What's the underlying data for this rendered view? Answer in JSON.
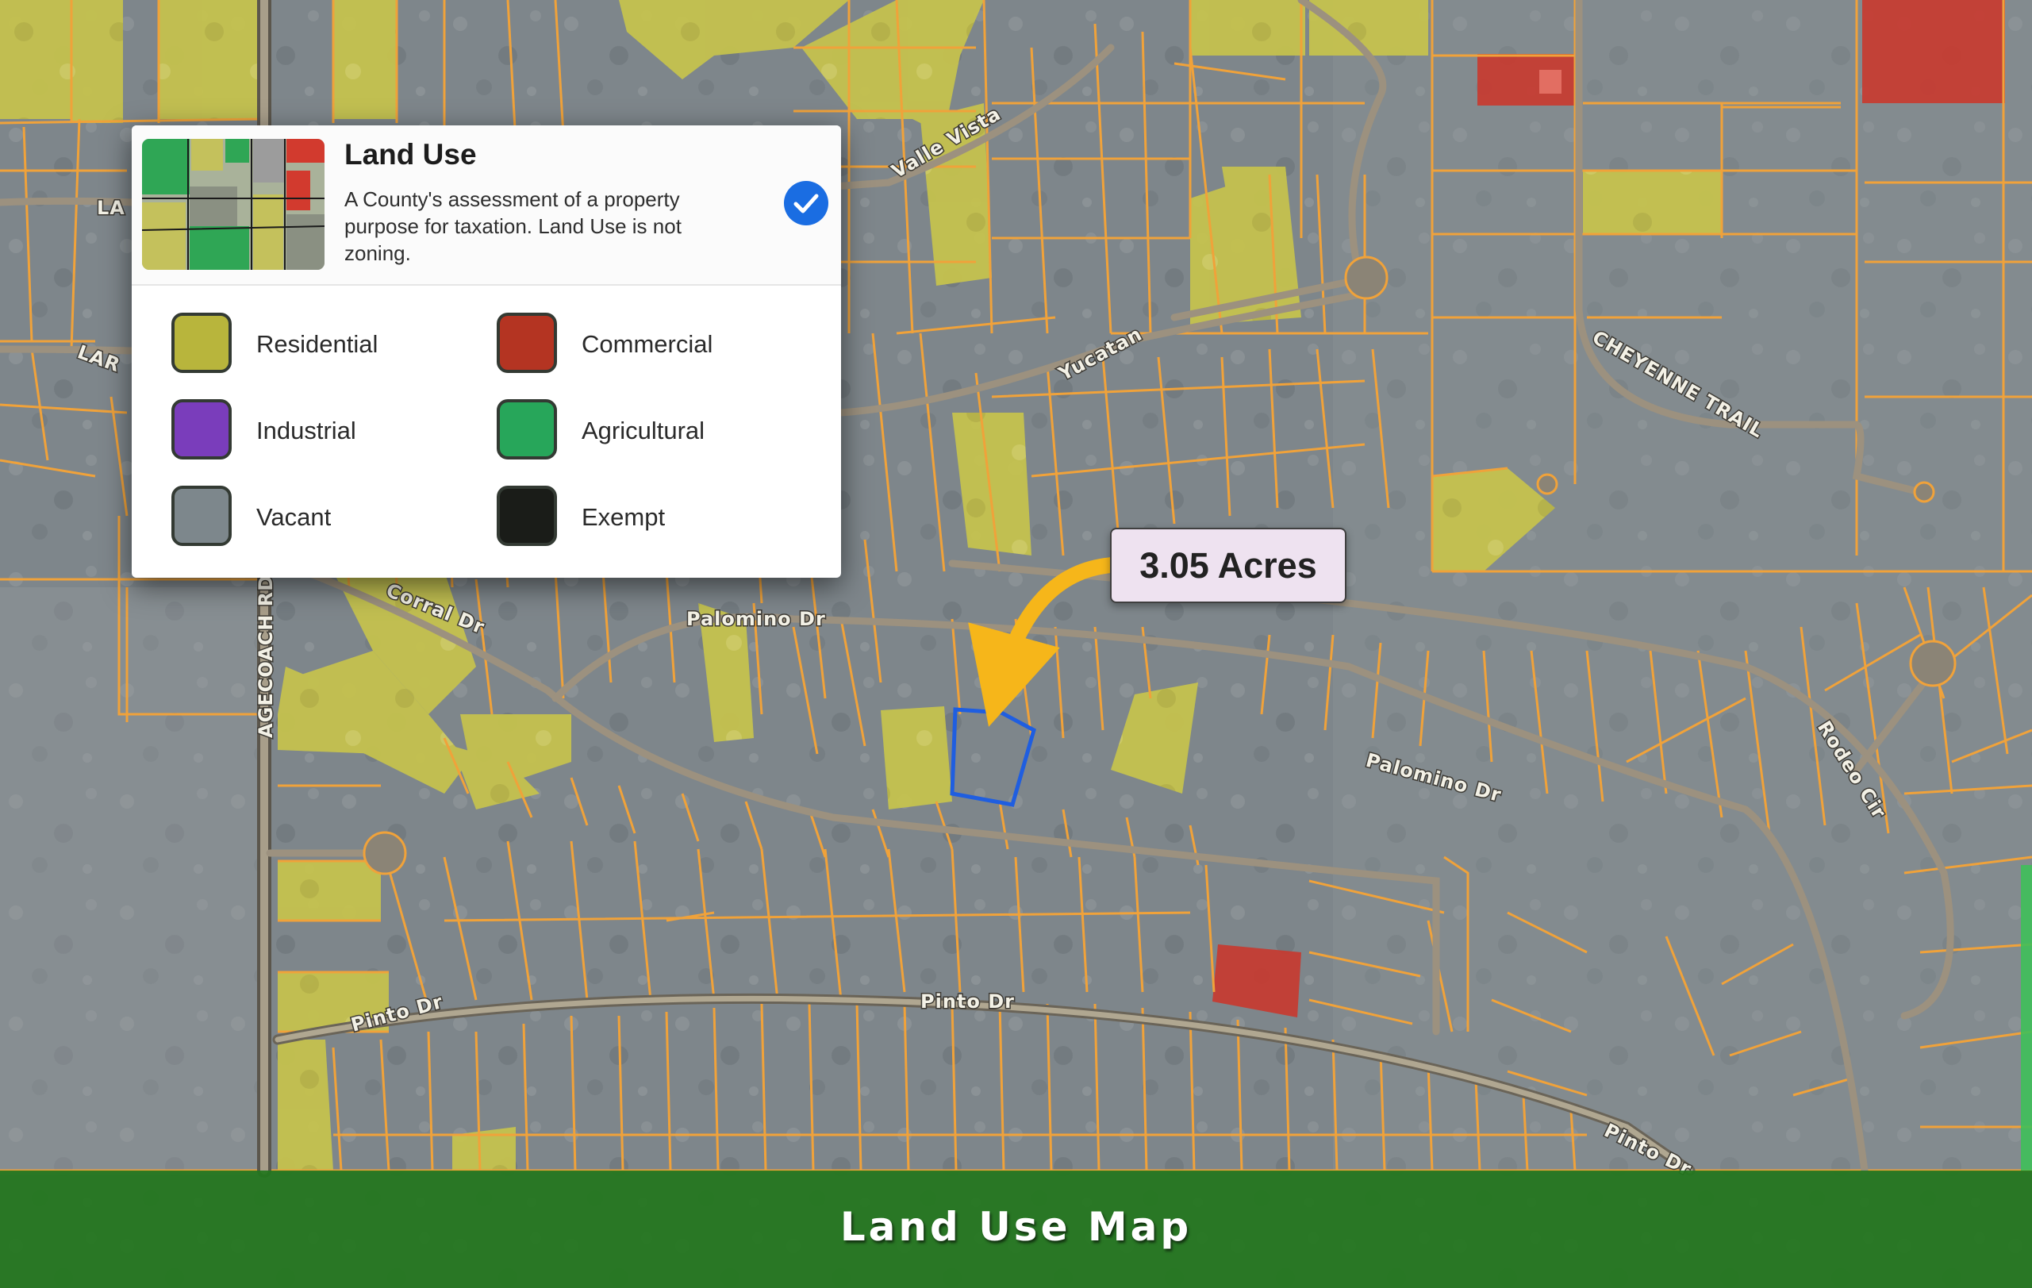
{
  "colors": {
    "parcel_line": "#f0a23a",
    "vacant_fill": "#7e868b",
    "residential_fill": "#c7c34c",
    "commercial_fill": "#c9392d",
    "selected_outline": "#1f5ee0",
    "arrow": "#f6b61a",
    "banner": "#22761c"
  },
  "legend": {
    "title": "Land Use",
    "description": "A County's assessment of a property purpose for taxation. Land Use is not zoning.",
    "checked": true,
    "icon": "checkmark-icon",
    "items": [
      {
        "label": "Residential",
        "color": "#b8b53c"
      },
      {
        "label": "Commercial",
        "color": "#b43422"
      },
      {
        "label": "Industrial",
        "color": "#7a3dbb"
      },
      {
        "label": "Agricultural",
        "color": "#27a65a"
      },
      {
        "label": "Vacant",
        "color": "#7d878c"
      },
      {
        "label": "Exempt",
        "color": "#1a1c18"
      }
    ]
  },
  "parcel": {
    "acreage_label": "3.05 Acres"
  },
  "roads": {
    "valle_vista": "Valle Vista",
    "yucatan": "Yucatan",
    "cheyenne_trail": "CHEYENNE TRAIL",
    "palomino_west": "Palomino Dr",
    "palomino_east": "Palomino Dr",
    "pinto_west": "Pinto Dr",
    "pinto_center": "Pinto Dr",
    "pinto_east": "Pinto Dr",
    "rodeo_cir": "Rodeo Cir",
    "stagecoach_rd": "AGECOACH RD",
    "lar_1": "LA",
    "lar_2": "LAR",
    "corral_dr": "Corral Dr"
  },
  "banner": {
    "title": "Land Use Map"
  }
}
